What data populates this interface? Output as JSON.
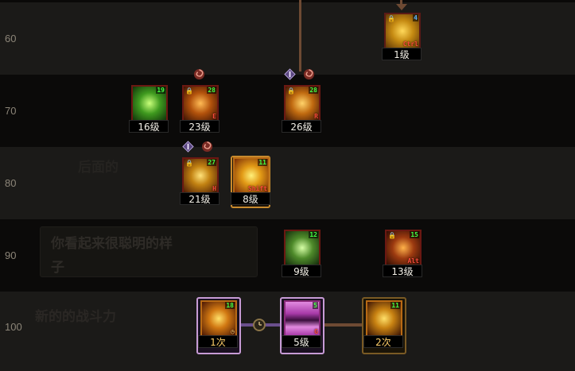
{
  "rows": [
    {
      "level": "60"
    },
    {
      "level": "70"
    },
    {
      "level": "80"
    },
    {
      "level": "90"
    },
    {
      "level": "100"
    }
  ],
  "ghost_text": {
    "line1": "你看起来很聪明的样",
    "line2": "子",
    "line3": "新的的战斗力",
    "line4": "后面的"
  },
  "skills": {
    "s60_ctrl": {
      "count": "4",
      "key": "Ctrl",
      "label": "1级"
    },
    "s70_green": {
      "count": "19",
      "label": "16级"
    },
    "s70_e": {
      "count": "28",
      "key": "E",
      "label": "23级"
    },
    "s70_r": {
      "count": "28",
      "key": "R",
      "label": "26级"
    },
    "s80_h": {
      "count": "27",
      "key": "H",
      "label": "21级"
    },
    "s80_shift": {
      "count": "11",
      "key": "Shift",
      "label": "8级"
    },
    "s90_green": {
      "count": "12",
      "label": "9级"
    },
    "s90_alt": {
      "count": "15",
      "key": "Alt",
      "label": "13级"
    },
    "s100_a": {
      "count": "18",
      "label": "1次"
    },
    "s100_g": {
      "count": "5",
      "key": "G",
      "label": "5级"
    },
    "s100_c": {
      "count": "11",
      "label": "2次"
    }
  },
  "colors": {
    "line_brown": "#6e4a33",
    "line_purple": "#6a4f8c",
    "count_green": "#44ff44",
    "key_red": "#ff4b3a"
  }
}
